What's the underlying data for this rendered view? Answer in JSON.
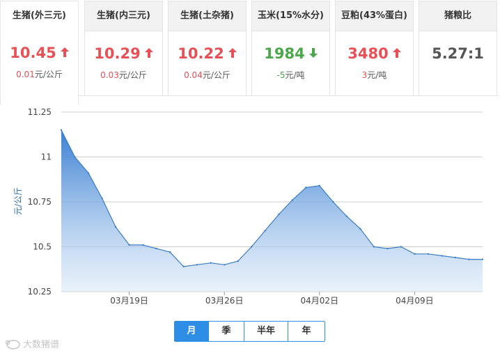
{
  "cards": [
    {
      "title": "生猪(外三元)",
      "price": "10.45",
      "trend": "up",
      "change": "0.01",
      "unit": "元/公斤",
      "active": true
    },
    {
      "title": "生猪(内三元)",
      "price": "10.29",
      "trend": "up",
      "change": "0.03",
      "unit": "元/公斤",
      "active": false
    },
    {
      "title": "生猪(土杂猪)",
      "price": "10.22",
      "trend": "up",
      "change": "0.04",
      "unit": "元/公斤",
      "active": false
    },
    {
      "title": "玉米(15%水分)",
      "price": "1984",
      "trend": "down",
      "change": "-5",
      "unit": "元/吨",
      "active": false
    },
    {
      "title": "豆粕(43%蛋白)",
      "price": "3480",
      "trend": "up",
      "change": "3",
      "unit": "元/吨",
      "active": false
    },
    {
      "title": "猪粮比",
      "price": "5.27:1",
      "trend": "neutral",
      "change": "",
      "unit": "",
      "active": false
    }
  ],
  "colors": {
    "up": "#e85055",
    "down": "#4aa74a",
    "accent": "#2e8ee6",
    "line": "#3a7cc8"
  },
  "period_tabs": [
    "月",
    "季",
    "半年",
    "年"
  ],
  "selected_period": "月",
  "watermark": "大数猪谱",
  "chart_data": {
    "type": "area",
    "ylabel": "元/公斤",
    "xlabel": "",
    "ylim": [
      10.25,
      11.25
    ],
    "yticks": [
      "10.25",
      "10.5",
      "10.75",
      "11",
      "11.25"
    ],
    "xticks": [
      {
        "label": "03月19日",
        "at": "03-19"
      },
      {
        "label": "03月26日",
        "at": "03-26"
      },
      {
        "label": "04月02日",
        "at": "04-02"
      },
      {
        "label": "04月09日",
        "at": "04-09"
      }
    ],
    "grid": true,
    "x": [
      "03-14",
      "03-15",
      "03-16",
      "03-17",
      "03-18",
      "03-19",
      "03-20",
      "03-21",
      "03-22",
      "03-23",
      "03-24",
      "03-25",
      "03-26",
      "03-27",
      "03-28",
      "03-29",
      "03-30",
      "03-31",
      "04-01",
      "04-02",
      "04-03",
      "04-04",
      "04-05",
      "04-06",
      "04-07",
      "04-08",
      "04-09",
      "04-10",
      "04-11",
      "04-12",
      "04-13",
      "04-14"
    ],
    "values": [
      11.15,
      11.0,
      10.91,
      10.77,
      10.61,
      10.51,
      10.51,
      10.49,
      10.47,
      10.39,
      10.4,
      10.41,
      10.4,
      10.42,
      10.5,
      10.59,
      10.68,
      10.76,
      10.83,
      10.84,
      10.75,
      10.67,
      10.6,
      10.5,
      10.49,
      10.5,
      10.46,
      10.46,
      10.45,
      10.44,
      10.43,
      10.43
    ]
  }
}
